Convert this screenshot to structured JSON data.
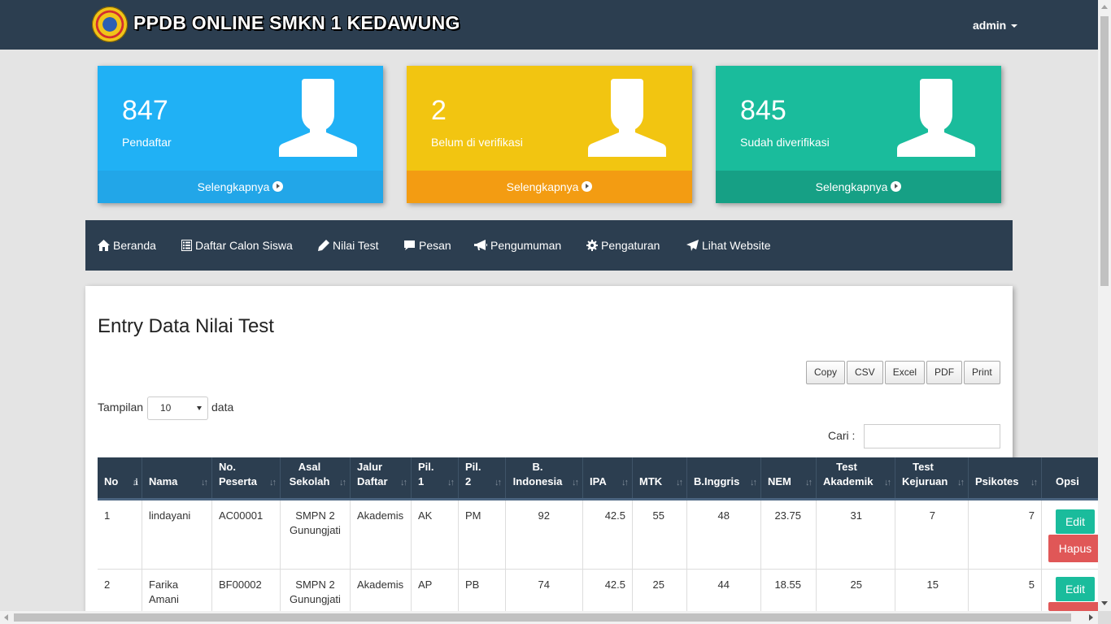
{
  "header": {
    "brand": "PPDB ONLINE SMKN 1 KEDAWUNG",
    "user": "admin"
  },
  "stats": [
    {
      "value": "847",
      "label": "Pendaftar",
      "link": "Selengkapnya",
      "color": "#20b1f5"
    },
    {
      "value": "2",
      "label": "Belum di verifikasi",
      "link": "Selengkapnya",
      "color": "#f2c511"
    },
    {
      "value": "845",
      "label": "Sudah diverifikasi",
      "link": "Selengkapnya",
      "color": "#1abc9c"
    }
  ],
  "nav": [
    {
      "label": "Beranda",
      "icon": "home-icon"
    },
    {
      "label": "Daftar Calon Siswa",
      "icon": "list-icon"
    },
    {
      "label": "Nilai Test",
      "icon": "pencil-icon"
    },
    {
      "label": "Pesan",
      "icon": "comment-icon"
    },
    {
      "label": "Pengumuman",
      "icon": "bullhorn-icon"
    },
    {
      "label": "Pengaturan",
      "icon": "gear-icon"
    },
    {
      "label": "Lihat Website",
      "icon": "send-icon"
    }
  ],
  "main": {
    "title": "Entry Data Nilai Test",
    "export_buttons": [
      "Copy",
      "CSV",
      "Excel",
      "PDF",
      "Print"
    ],
    "length_label": "Tampilan",
    "length_value": "10",
    "length_after": "data",
    "search_label": "Cari :"
  },
  "table": {
    "columns": [
      [
        "No",
        ""
      ],
      [
        "Nama",
        ""
      ],
      [
        "No.",
        "Peserta"
      ],
      [
        "Asal",
        "Sekolah"
      ],
      [
        "Jalur",
        "Daftar"
      ],
      [
        "Pil.",
        "1"
      ],
      [
        "Pil.",
        "2"
      ],
      [
        "B.",
        "Indonesia"
      ],
      [
        "IPA",
        ""
      ],
      [
        "MTK",
        ""
      ],
      [
        "B.Inggris",
        ""
      ],
      [
        "NEM",
        ""
      ],
      [
        "Test",
        "Akademik"
      ],
      [
        "Test",
        "Kejuruan"
      ],
      [
        "Psikotes",
        ""
      ],
      [
        "Opsi",
        ""
      ]
    ],
    "rows": [
      {
        "no": "1",
        "nama": [
          "lindayani",
          ""
        ],
        "peserta": "AC00001",
        "sekolah": [
          "SMPN 2",
          "Gunungjati"
        ],
        "jalur": "Akademis",
        "pil1": "AK",
        "pil2": "PM",
        "bind": "92",
        "ipa": "42.5",
        "mtk": "55",
        "bing": "48",
        "nem": "23.75",
        "akademik": "31",
        "kejuruan": "7",
        "psikotes": "7"
      },
      {
        "no": "2",
        "nama": [
          "Farika",
          "Amani"
        ],
        "peserta": "BF00002",
        "sekolah": [
          "SMPN 2",
          "Gunungjati"
        ],
        "jalur": "Akademis",
        "pil1": "AP",
        "pil2": "PB",
        "bind": "74",
        "ipa": "42.5",
        "mtk": "25",
        "bing": "44",
        "nem": "18.55",
        "akademik": "25",
        "kejuruan": "15",
        "psikotes": "5"
      }
    ],
    "edit_label": "Edit",
    "delete_label": "Hapus"
  }
}
